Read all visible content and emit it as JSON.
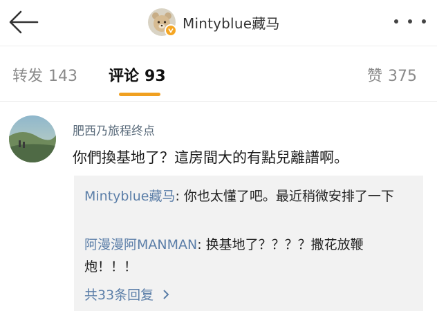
{
  "header": {
    "username": "Mintyblue藏马",
    "back_icon": "arrow-left-icon",
    "more_icon": "more-dots-icon",
    "badge_icon": "verified-v-icon",
    "badge_color": "#f5a623"
  },
  "tabs": [
    {
      "label": "转发",
      "count": "143"
    },
    {
      "label": "评论",
      "count": "93"
    },
    {
      "label": "赞",
      "count": "375"
    }
  ],
  "active_tab_color": "#f0a020",
  "comment": {
    "user": "肥西乃旅程终点",
    "text": "你們換基地了？這房間大的有點兒離譜啊。",
    "replies": [
      {
        "user": "Mintyblue藏马",
        "text": ": 你也太懂了吧。最近稍微安排了一下"
      },
      {
        "user": "阿漫漫阿MANMAN",
        "text": ": 换基地了？？？？撒花放鞭炮！！！"
      }
    ],
    "more_replies": "共33条回复",
    "more_replies_icon": "chevron-right-icon"
  },
  "link_color": "#5b7ea8"
}
